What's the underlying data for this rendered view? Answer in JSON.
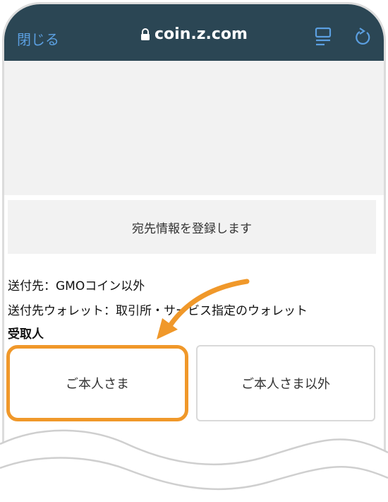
{
  "browser": {
    "close_label": "閉じる",
    "url": "coin.z.com",
    "lock_icon": "lock-icon",
    "reader_icon": "reader-icon",
    "reload_icon": "reload-icon"
  },
  "page": {
    "register_label": "宛先情報を登録します",
    "destination": "送付先：GMOコイン以外",
    "wallet": "送付先ウォレット：取引所・サービス指定のウォレット",
    "recipient_heading": "受取人",
    "options": [
      {
        "label": "ご本人さま",
        "highlighted": true
      },
      {
        "label": "ご本人さま以外",
        "highlighted": false
      }
    ]
  },
  "colors": {
    "browser_bar": "#2b4654",
    "link_blue": "#5b9fe0",
    "highlight_orange": "#f0982a"
  }
}
